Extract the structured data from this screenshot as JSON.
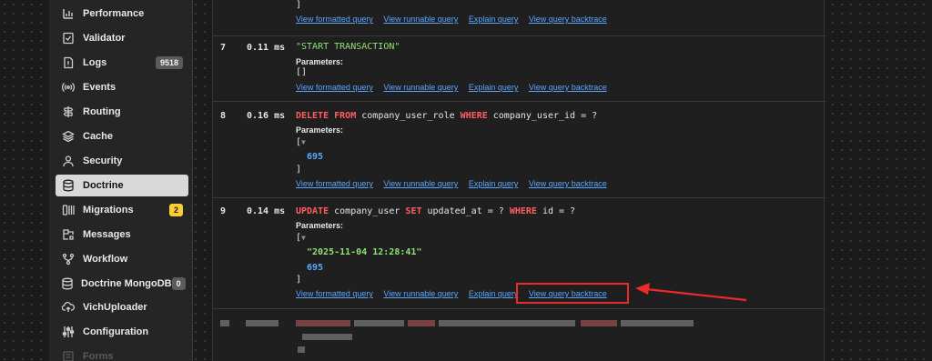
{
  "sidebar": {
    "items": [
      {
        "label": "Performance",
        "icon": "performance-icon"
      },
      {
        "label": "Validator",
        "icon": "validator-icon"
      },
      {
        "label": "Logs",
        "icon": "logs-icon",
        "badge": "9518"
      },
      {
        "label": "Events",
        "icon": "events-icon"
      },
      {
        "label": "Routing",
        "icon": "routing-icon"
      },
      {
        "label": "Cache",
        "icon": "cache-icon"
      },
      {
        "label": "Security",
        "icon": "security-icon"
      },
      {
        "label": "Doctrine",
        "icon": "doctrine-icon",
        "active": true
      },
      {
        "label": "Migrations",
        "icon": "migrations-icon",
        "badge": "2"
      },
      {
        "label": "Messages",
        "icon": "messages-icon"
      },
      {
        "label": "Workflow",
        "icon": "workflow-icon"
      },
      {
        "label": "Doctrine MongoDB",
        "icon": "mongodb-icon",
        "badge": "0"
      },
      {
        "label": "VichUploader",
        "icon": "upload-icon"
      },
      {
        "label": "Configuration",
        "icon": "configuration-icon"
      },
      {
        "label": "Forms",
        "icon": "forms-icon",
        "disabled": true
      }
    ]
  },
  "links": {
    "formatted": "View formatted query",
    "runnable": "View runnable query",
    "explain": "Explain query",
    "backtrace": "View query backtrace"
  },
  "queries": {
    "prev": {
      "close": "]"
    },
    "q7": {
      "num": "7",
      "time": "0.11 ms",
      "sql": "\"START TRANSACTION\"",
      "params_label": "Parameters:",
      "params": "[]"
    },
    "q8": {
      "num": "8",
      "time": "0.16 ms",
      "sql": {
        "kw1": "DELETE FROM",
        "t1": " company_user_role ",
        "kw2": "WHERE",
        "t2": " company_user_id = ?"
      },
      "params_label": "Parameters:",
      "open": "[",
      "toggle": "▼",
      "values": [
        "695"
      ],
      "close": "]"
    },
    "q9": {
      "num": "9",
      "time": "0.14 ms",
      "sql": {
        "kw1": "UPDATE",
        "t1": " company_user ",
        "kw2": "SET",
        "t2": " updated_at = ? ",
        "kw3": "WHERE",
        "t3": " id = ?"
      },
      "params_label": "Parameters:",
      "open": "[",
      "toggle": "▼",
      "values": [
        "\"2025-11-04 12:28:41\"",
        "695"
      ],
      "close": "]"
    }
  },
  "colors": {
    "accent_link": "#5aa6ff",
    "keyword": "#ff5d62",
    "string": "#8fe07a",
    "number": "#5da8ff",
    "highlight": "#ec2a2a"
  }
}
